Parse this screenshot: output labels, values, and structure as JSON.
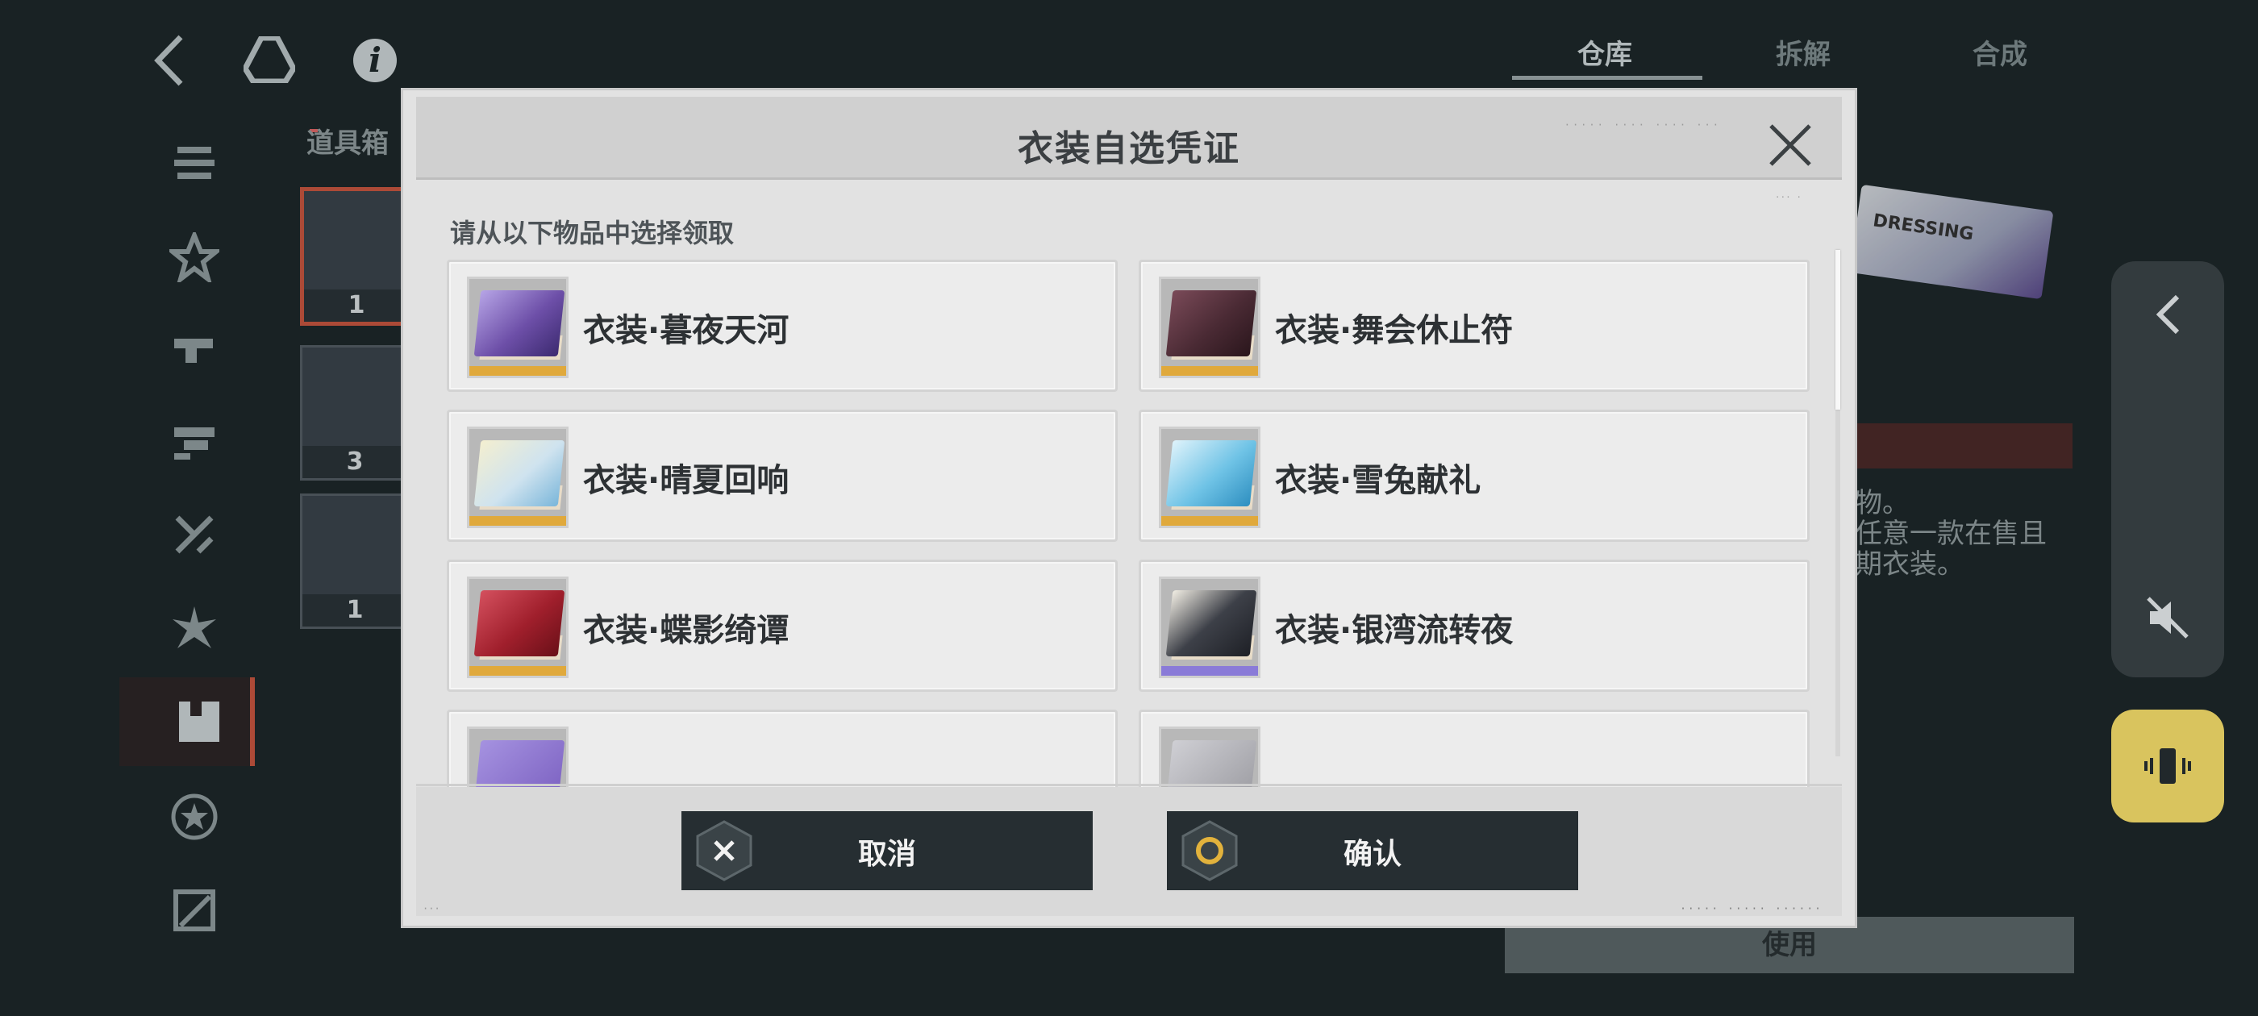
{
  "background": {
    "top_tabs": [
      "仓库",
      "拆解",
      "合成"
    ],
    "items_section_label": "道具箱",
    "inventory_counts": [
      "1",
      "3",
      "1"
    ],
    "right_panel_lines": [
      "物。",
      "任意一款在售且",
      "期衣装。"
    ],
    "use_button": "使用",
    "right_card_text": "DRESSING"
  },
  "modal": {
    "title": "衣装自选凭证",
    "prompt": "请从以下物品中选择领取",
    "options": [
      {
        "name": "衣装·暮夜天河",
        "rarity_color": "#e0a93c",
        "box_color": "#6d4fa8"
      },
      {
        "name": "衣装·舞会休止符",
        "rarity_color": "#e0a93c",
        "box_color": "#4a2a34"
      },
      {
        "name": "衣装·晴夏回响",
        "rarity_color": "#e0a93c",
        "box_color": "#cfe3ef"
      },
      {
        "name": "衣装·雪兔献礼",
        "rarity_color": "#e0a93c",
        "box_color": "#6fc3e6"
      },
      {
        "name": "衣装·蝶影绮谭",
        "rarity_color": "#e0a93c",
        "box_color": "#a01f2c"
      },
      {
        "name": "衣装·银湾流转夜",
        "rarity_color": "#8a7bd8",
        "box_color": "#3d4048"
      },
      {
        "name": "",
        "rarity_color": "#e0a93c",
        "box_color": "#7a5fc0"
      },
      {
        "name": "",
        "rarity_color": "#e0a93c",
        "box_color": "#9a9aa0"
      }
    ],
    "cancel_label": "取消",
    "confirm_label": "确认"
  },
  "colors": {
    "accent_red": "#c4553f",
    "button_dark": "#262e32",
    "vibrate_yellow": "#f7e06b"
  }
}
